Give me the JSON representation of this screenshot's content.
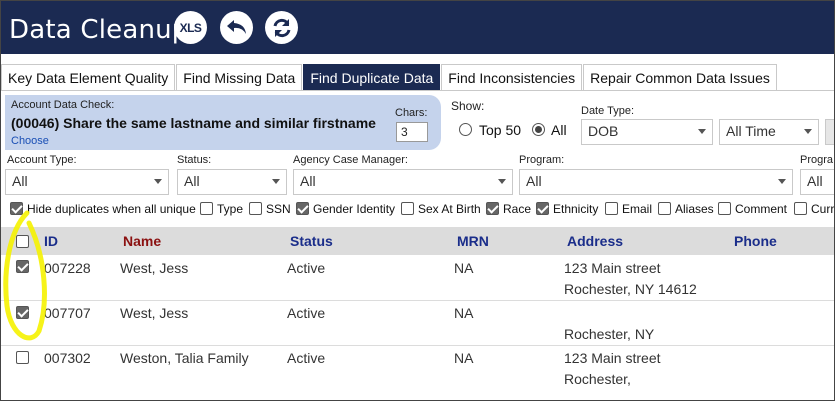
{
  "header": {
    "title": "Data Cleanup",
    "xls_label": "XLS"
  },
  "tabs": [
    {
      "label": "Key Data Element Quality",
      "active": false
    },
    {
      "label": "Find Missing Data",
      "active": false
    },
    {
      "label": "Find Duplicate Data",
      "active": true
    },
    {
      "label": "Find Inconsistencies",
      "active": false
    },
    {
      "label": "Repair Common Data Issues",
      "active": false
    }
  ],
  "account_check": {
    "label": "Account Data Check:",
    "value": "(00046) Share the same lastname and similar firstname",
    "choose": "Choose",
    "chars_label": "Chars:",
    "chars_value": "3"
  },
  "show": {
    "label": "Show:",
    "options": [
      {
        "label": "Top 50",
        "selected": false
      },
      {
        "label": "All",
        "selected": true
      }
    ]
  },
  "date_type": {
    "label": "Date Type:",
    "value": "DOB",
    "range": "All Time"
  },
  "filters": {
    "account_type": {
      "label": "Account Type:",
      "value": "All"
    },
    "status": {
      "label": "Status:",
      "value": "All"
    },
    "agency_case_manager": {
      "label": "Agency Case Manager:",
      "value": "All"
    },
    "program": {
      "label": "Program:",
      "value": "All"
    },
    "program_cut": {
      "label": "Progra",
      "value": "All"
    }
  },
  "options": [
    {
      "label": "Hide duplicates when all unique",
      "checked": true
    },
    {
      "label": "Type",
      "checked": false
    },
    {
      "label": "SSN",
      "checked": false
    },
    {
      "label": "Gender Identity",
      "checked": true
    },
    {
      "label": "Sex At Birth",
      "checked": false
    },
    {
      "label": "Race",
      "checked": true
    },
    {
      "label": "Ethnicity",
      "checked": true
    },
    {
      "label": "Email",
      "checked": false
    },
    {
      "label": "Aliases",
      "checked": false
    },
    {
      "label": "Comment",
      "checked": false
    },
    {
      "label": "Curr",
      "checked": false
    }
  ],
  "table": {
    "columns": [
      "ID",
      "Name",
      "Status",
      "MRN",
      "Address",
      "Phone"
    ],
    "rows": [
      {
        "checked": true,
        "id": "007228",
        "name": "West, Jess",
        "status": "Active",
        "mrn": "NA",
        "address1": "123 Main street",
        "address2": "Rochester, NY 14612"
      },
      {
        "checked": true,
        "id": "007707",
        "name": "West, Jess",
        "status": "Active",
        "mrn": "NA",
        "address1": "",
        "address2": "Rochester, NY"
      },
      {
        "checked": false,
        "id": "007302",
        "name": "Weston, Talia Family",
        "status": "Active",
        "mrn": "NA",
        "address1": "123 Main street",
        "address2": "Rochester,"
      }
    ]
  },
  "colors": {
    "header_bg": "#1b2a52",
    "active_tab": "#1b2a52",
    "panel_bg": "#c5d3ec",
    "annotation": "#f5f200"
  }
}
